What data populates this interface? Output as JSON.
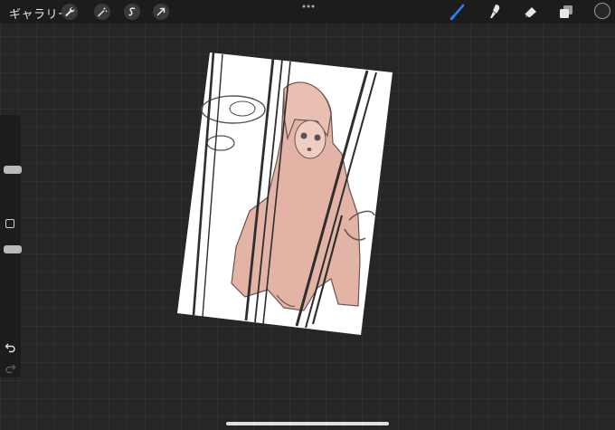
{
  "topbar": {
    "gallery_label": "ギャラリー",
    "left_tools": [
      "wrench-icon",
      "magic-wand-icon",
      "selection-icon",
      "transform-arrow-icon"
    ],
    "right_tools": [
      "brush-icon",
      "smudge-icon",
      "eraser-icon",
      "layers-icon",
      "color-swatch"
    ]
  },
  "colors": {
    "background": "#262626",
    "bar": "#1c1c1c",
    "active_brush": "#2f7bf5",
    "skin_fill": "#e3b4a6",
    "line": "#3a3a3a"
  },
  "sidebar": {
    "brush_size_level": 0.62,
    "opacity_level": 0.62
  }
}
